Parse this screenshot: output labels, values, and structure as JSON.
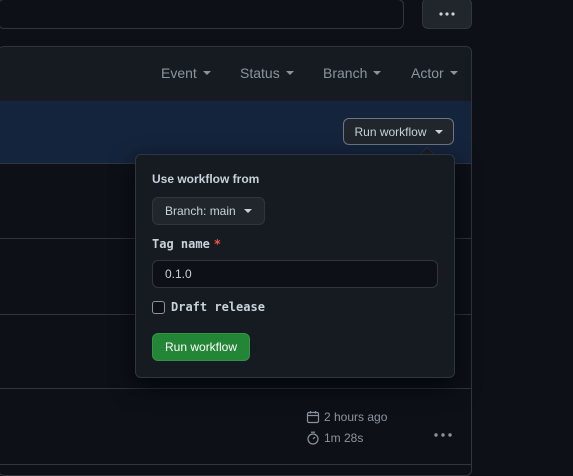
{
  "filters": {
    "event": "Event",
    "status": "Status",
    "branch": "Branch",
    "actor": "Actor"
  },
  "run_trigger": {
    "label": "Run workflow"
  },
  "popover": {
    "heading": "Use workflow from",
    "branch_button": "Branch: main",
    "tag_label": "Tag name",
    "required_marker": "*",
    "tag_value": "0.1.0",
    "draft_label": "Draft release",
    "draft_checked": false,
    "submit_label": "Run workflow"
  },
  "run_meta": {
    "time_ago": "2 hours ago",
    "duration": "1m 28s"
  },
  "colors": {
    "accent_green": "#238636",
    "banner_blue": "#15243d",
    "required_red": "#f85149"
  },
  "icons": {
    "top_kebab": "kebab-horizontal-icon",
    "row_kebab": "kebab-horizontal-icon",
    "calendar": "calendar-icon",
    "stopwatch": "stopwatch-icon",
    "caret": "triangle-down-icon"
  }
}
